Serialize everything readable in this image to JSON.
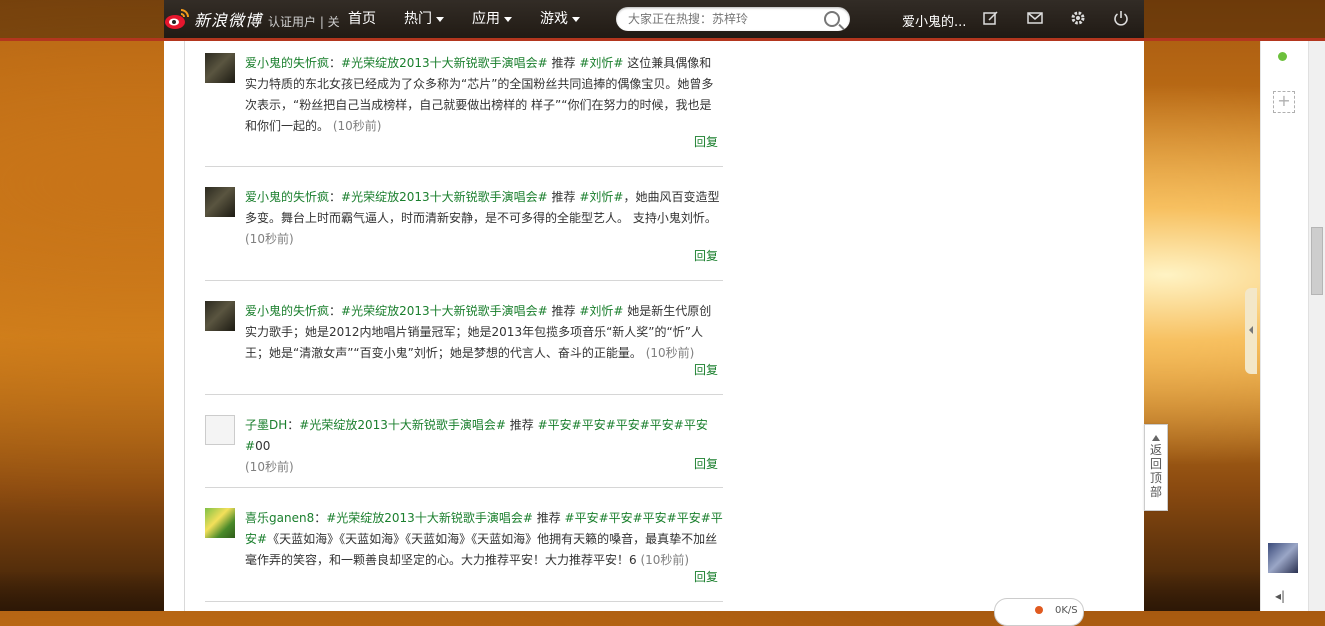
{
  "topbar": {
    "logo_text": "新浪微博",
    "behind_nav_text": "认证用户 | 关",
    "nav": [
      {
        "label": "首页",
        "has_caret": false
      },
      {
        "label": "热门",
        "has_caret": true
      },
      {
        "label": "应用",
        "has_caret": true
      },
      {
        "label": "游戏",
        "has_caret": true
      }
    ],
    "search_placeholder": "大家正在热搜：苏梓玲",
    "username": "爱小鬼的...",
    "accent_color": "#b3361e"
  },
  "feed": {
    "reply_label": "回复",
    "items": [
      {
        "avatar": "dark",
        "user": "爱小鬼的失忻疯",
        "topic": "#光荣绽放2013十大新锐歌手演唱会#",
        "mid": " 推荐 ",
        "tag": "#刘忻#",
        "body": " 这位兼具偶像和实力特质的东北女孩已经成为了众多称为“芯片”的全国粉丝共同追捧的偶像宝贝。她曾多次表示，“粉丝把自己当成榜样，自己就要做出榜样的 样子”“你们在努力的时候，我也是和你们一起的。",
        "time": "(10秒前)"
      },
      {
        "avatar": "dark",
        "user": "爱小鬼的失忻疯",
        "topic": "#光荣绽放2013十大新锐歌手演唱会#",
        "mid": " 推荐 ",
        "tag": "#刘忻#",
        "body": "，她曲风百变造型多变。舞台上时而霸气逼人，时而清新安静，是不可多得的全能型艺人。 支持小鬼刘忻。",
        "time": "(10秒前)"
      },
      {
        "avatar": "dark",
        "user": "爱小鬼的失忻疯",
        "topic": "#光荣绽放2013十大新锐歌手演唱会#",
        "mid": " 推荐 ",
        "tag": "#刘忻#",
        "body": " 她是新生代原创实力歌手；她是2012内地唱片销量冠军；她是2013年包揽多项音乐“新人奖”的“忻”人王；她是“清澈女声”“百变小鬼”刘忻；她是梦想的代言人、奋斗的正能量。",
        "time": "(10秒前)"
      },
      {
        "avatar": "blank",
        "user": "子墨DH",
        "topic": "#光荣绽放2013十大新锐歌手演唱会#",
        "mid": " 推荐 ",
        "tag": "#平安#平安#平安#平安#平安#",
        "body": "00",
        "time": "(10秒前)"
      },
      {
        "avatar": "flower",
        "user": "喜乐ganen8",
        "topic": "#光荣绽放2013十大新锐歌手演唱会#",
        "mid": " 推荐 ",
        "tag": "#平安#平安#平安#平安#平安#",
        "body": "《天蓝如海》《天蓝如海》《天蓝如海》《天蓝如海》他拥有天籁的嗓音，最真挚不加丝毫作弄的笑容，和一颗善良却坚定的心。大力推荐平安！大力推荐平安！6",
        "time": "(10秒前)"
      }
    ]
  },
  "backtop": {
    "label": "返回顶部"
  },
  "widget": {
    "label": "0K/S"
  }
}
